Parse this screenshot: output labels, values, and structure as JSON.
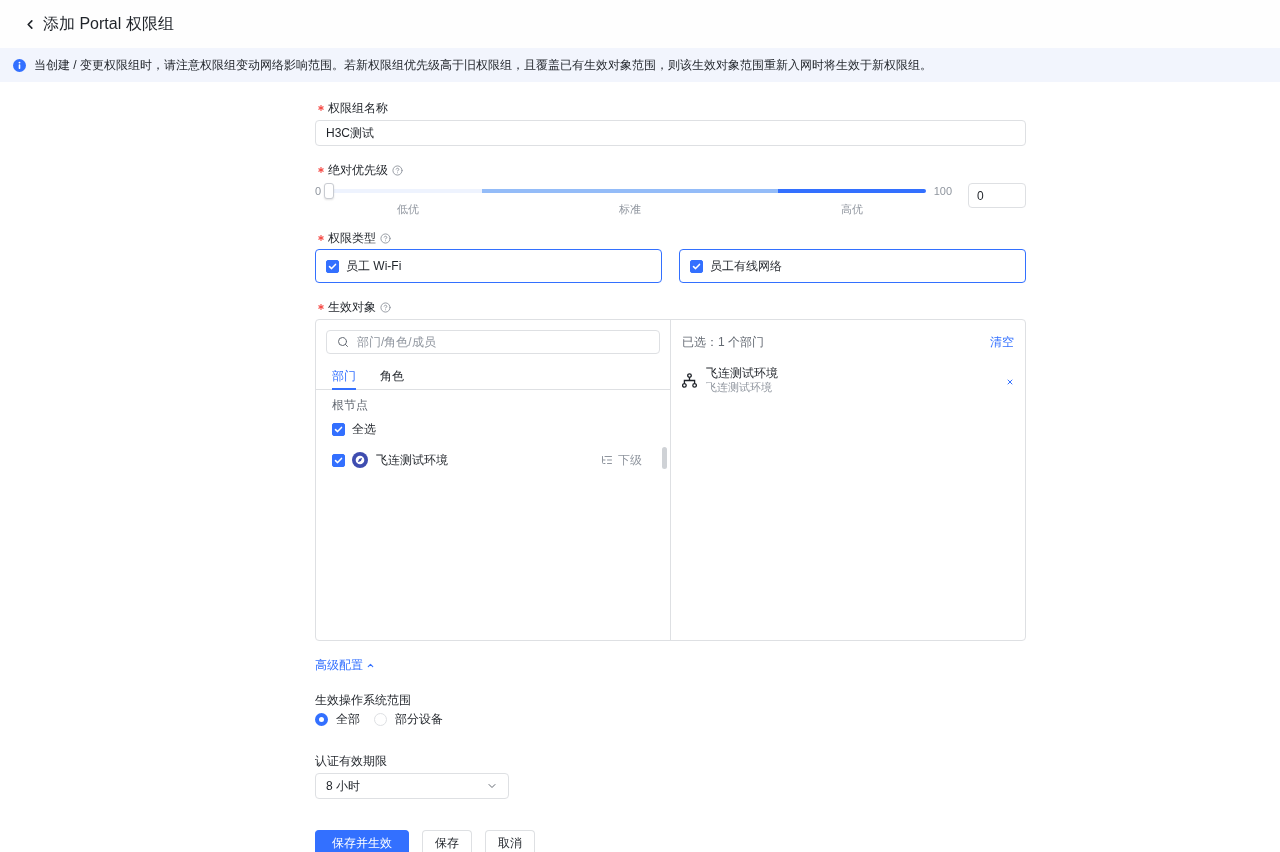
{
  "header": {
    "title": "添加 Portal 权限组"
  },
  "notice": {
    "text": "当创建 / 变更权限组时，请注意权限组变动网络影响范围。若新权限组优先级高于旧权限组，且覆盖已有生效对象范围，则该生效对象范围重新入网时将生效于新权限组。"
  },
  "form": {
    "group_name": {
      "label": "权限组名称",
      "required": true,
      "value": "H3C测试"
    },
    "priority": {
      "label": "绝对优先级",
      "required": true,
      "help": true,
      "min": "0",
      "max": "100",
      "level": 0,
      "value": "0",
      "bands": [
        {
          "label": "低优",
          "color": "#eef3fe"
        },
        {
          "label": "标准",
          "color": "#94bcf8"
        },
        {
          "label": "高优",
          "color": "#3370ff"
        }
      ]
    },
    "permission_types": {
      "label": "权限类型",
      "required": true,
      "help": true,
      "options": [
        {
          "label": "员工 Wi-Fi",
          "checked": true
        },
        {
          "label": "员工有线网络",
          "checked": true
        }
      ]
    },
    "targets": {
      "label": "生效对象",
      "required": true,
      "help": true,
      "search": {
        "placeholder": "部门/角色/成员"
      },
      "tabs": [
        {
          "label": "部门",
          "selected": true
        },
        {
          "label": "角色",
          "selected": false
        }
      ],
      "tree": {
        "root_label": "根节点",
        "select_all": {
          "label": "全选",
          "checked": true
        },
        "items": [
          {
            "name": "飞连测试环境",
            "checked": true,
            "action": "下级"
          }
        ]
      },
      "selected_panel": {
        "summary": "已选：1 个部门",
        "clear": "清空",
        "items": [
          {
            "name": "飞连测试环境",
            "path": "飞连测试环境"
          }
        ]
      }
    },
    "advanced": {
      "label": "高级配置",
      "expanded": true
    },
    "os_range": {
      "label": "生效操作系统范围",
      "options": [
        {
          "label": "全部",
          "selected": true
        },
        {
          "label": "部分设备",
          "selected": false
        }
      ]
    },
    "auth_period": {
      "label": "认证有效期限",
      "value": "8 小时"
    }
  },
  "actions": [
    {
      "label": "保存并生效",
      "kind": "primary"
    },
    {
      "label": "保存",
      "kind": "default"
    },
    {
      "label": "取消",
      "kind": "default"
    }
  ]
}
